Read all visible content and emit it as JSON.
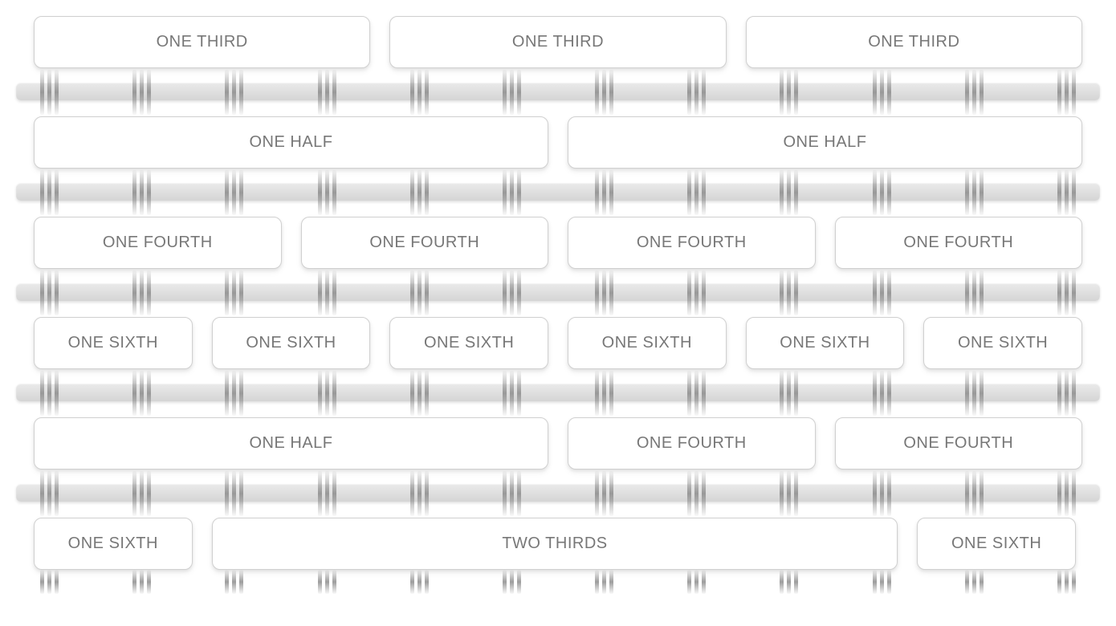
{
  "rows": [
    {
      "cells": [
        {
          "label": "ONE THIRD",
          "width": "one-third"
        },
        {
          "label": "ONE THIRD",
          "width": "one-third"
        },
        {
          "label": "ONE THIRD",
          "width": "one-third"
        }
      ]
    },
    {
      "cells": [
        {
          "label": "ONE HALF",
          "width": "one-half"
        },
        {
          "label": "ONE HALF",
          "width": "one-half"
        }
      ]
    },
    {
      "cells": [
        {
          "label": "ONE FOURTH",
          "width": "one-fourth"
        },
        {
          "label": "ONE FOURTH",
          "width": "one-fourth"
        },
        {
          "label": "ONE FOURTH",
          "width": "one-fourth"
        },
        {
          "label": "ONE FOURTH",
          "width": "one-fourth"
        }
      ]
    },
    {
      "cells": [
        {
          "label": "ONE SIXTH",
          "width": "one-sixth"
        },
        {
          "label": "ONE SIXTH",
          "width": "one-sixth"
        },
        {
          "label": "ONE SIXTH",
          "width": "one-sixth"
        },
        {
          "label": "ONE SIXTH",
          "width": "one-sixth"
        },
        {
          "label": "ONE SIXTH",
          "width": "one-sixth"
        },
        {
          "label": "ONE SIXTH",
          "width": "one-sixth"
        }
      ]
    },
    {
      "cells": [
        {
          "label": "ONE HALF",
          "width": "one-half"
        },
        {
          "label": "ONE FOURTH",
          "width": "one-fourth"
        },
        {
          "label": "ONE FOURTH",
          "width": "one-fourth"
        }
      ]
    },
    {
      "cells": [
        {
          "label": "ONE SIXTH",
          "width": "one-sixth"
        },
        {
          "label": "TWO THIRDS",
          "width": "two-thirds"
        },
        {
          "label": "ONE SIXTH",
          "width": "one-sixth"
        }
      ]
    }
  ]
}
